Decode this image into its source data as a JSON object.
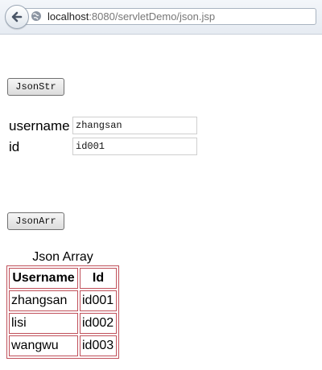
{
  "browser": {
    "url_host": "localhost",
    "url_rest": ":8080/servletDemo/json.jsp"
  },
  "page": {
    "json_str_button": "JsonStr",
    "json_arr_button": "JsonArr",
    "username_label": "username",
    "id_label": "id",
    "username_value": "zhangsan",
    "id_value": "id001"
  },
  "table": {
    "caption": "Json Array",
    "headers": [
      "Username",
      "Id"
    ],
    "rows": [
      [
        "zhangsan",
        "id001"
      ],
      [
        "lisi",
        "id002"
      ],
      [
        "wangwu",
        "id003"
      ]
    ]
  },
  "colors": {
    "table_border": "#c0505a"
  }
}
